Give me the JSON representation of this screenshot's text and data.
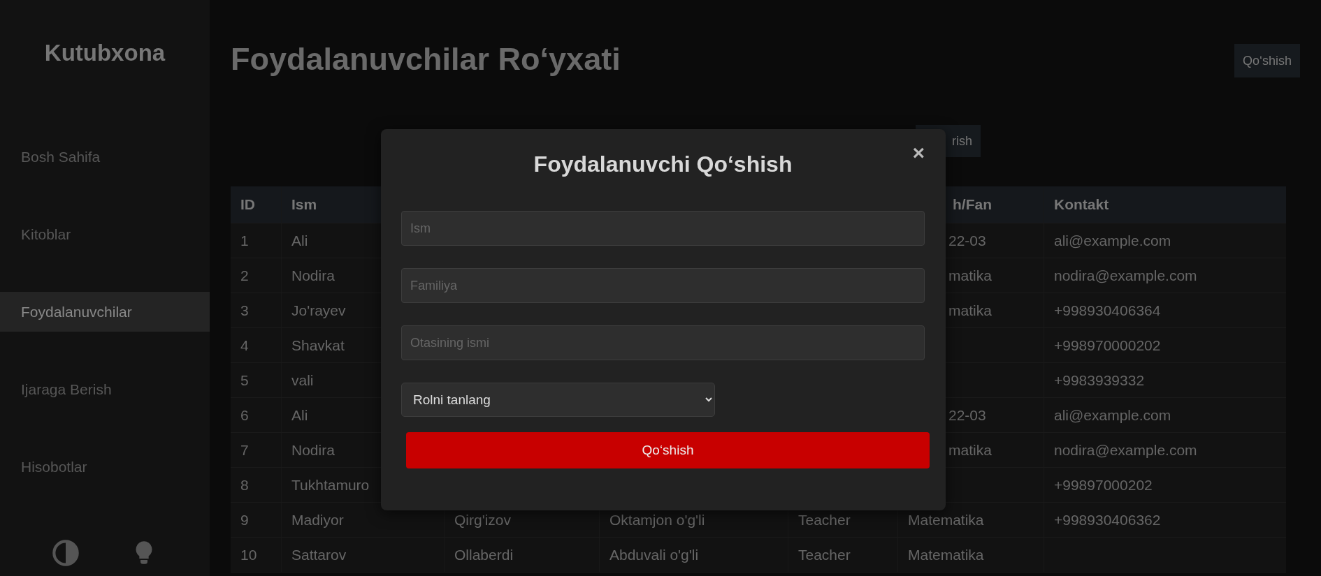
{
  "sidebar": {
    "logo": "Kutubxona",
    "items": [
      {
        "label": "Bosh Sahifa",
        "selected": false
      },
      {
        "label": "Kitoblar",
        "selected": false
      },
      {
        "label": "Foydalanuvchilar",
        "selected": true
      },
      {
        "label": "Ijaraga Berish",
        "selected": false
      },
      {
        "label": "Hisobotlar",
        "selected": false
      }
    ]
  },
  "page": {
    "title": "Foydalanuvchilar Ro‘yxati",
    "add_button": "Qo‘shish",
    "toolbar_button": "rish"
  },
  "table": {
    "columns": {
      "id": "ID",
      "ism": "Ism",
      "fan": "h/Fan",
      "kontakt": "Kontakt"
    },
    "rows": [
      {
        "id": "1",
        "ism": "Ali",
        "fan": "22-03",
        "kontakt": "ali@example.com"
      },
      {
        "id": "2",
        "ism": "Nodira",
        "fan": "matika",
        "kontakt": "nodira@example.com"
      },
      {
        "id": "3",
        "ism": "Jo'rayev",
        "fan": "matika",
        "kontakt": "+998930406364"
      },
      {
        "id": "4",
        "ism": "Shavkat",
        "kontakt": "+998970000202"
      },
      {
        "id": "5",
        "ism": "vali",
        "kontakt": "+9983939332"
      },
      {
        "id": "6",
        "ism": "Ali",
        "fan": "22-03",
        "kontakt": "ali@example.com"
      },
      {
        "id": "7",
        "ism": "Nodira",
        "fan": "matika",
        "kontakt": "nodira@example.com"
      },
      {
        "id": "8",
        "ism": "Tukhtamuro",
        "kontakt": "+99897000202"
      },
      {
        "id": "9",
        "ism": "Madiyor",
        "column_3": "Qirg'izov",
        "column_4": "Oktamjon o'g'li",
        "column_5": "Teacher",
        "fan": "Matematika",
        "kontakt": "+998930406362"
      },
      {
        "id": "10",
        "ism": "Sattarov",
        "column_3": "Ollaberdi",
        "column_4": "Abduvali o'g'li",
        "column_5": "Teacher",
        "fan": "Matematika"
      }
    ]
  },
  "modal": {
    "title": "Foydalanuvchi Qo‘shish",
    "close": "×",
    "fields": [
      {
        "placeholder": "Ism"
      },
      {
        "placeholder": "Familiya"
      },
      {
        "placeholder": "Otasining ismi"
      }
    ],
    "select": "Rolni tanlang",
    "submit": "Qo‘shish"
  }
}
